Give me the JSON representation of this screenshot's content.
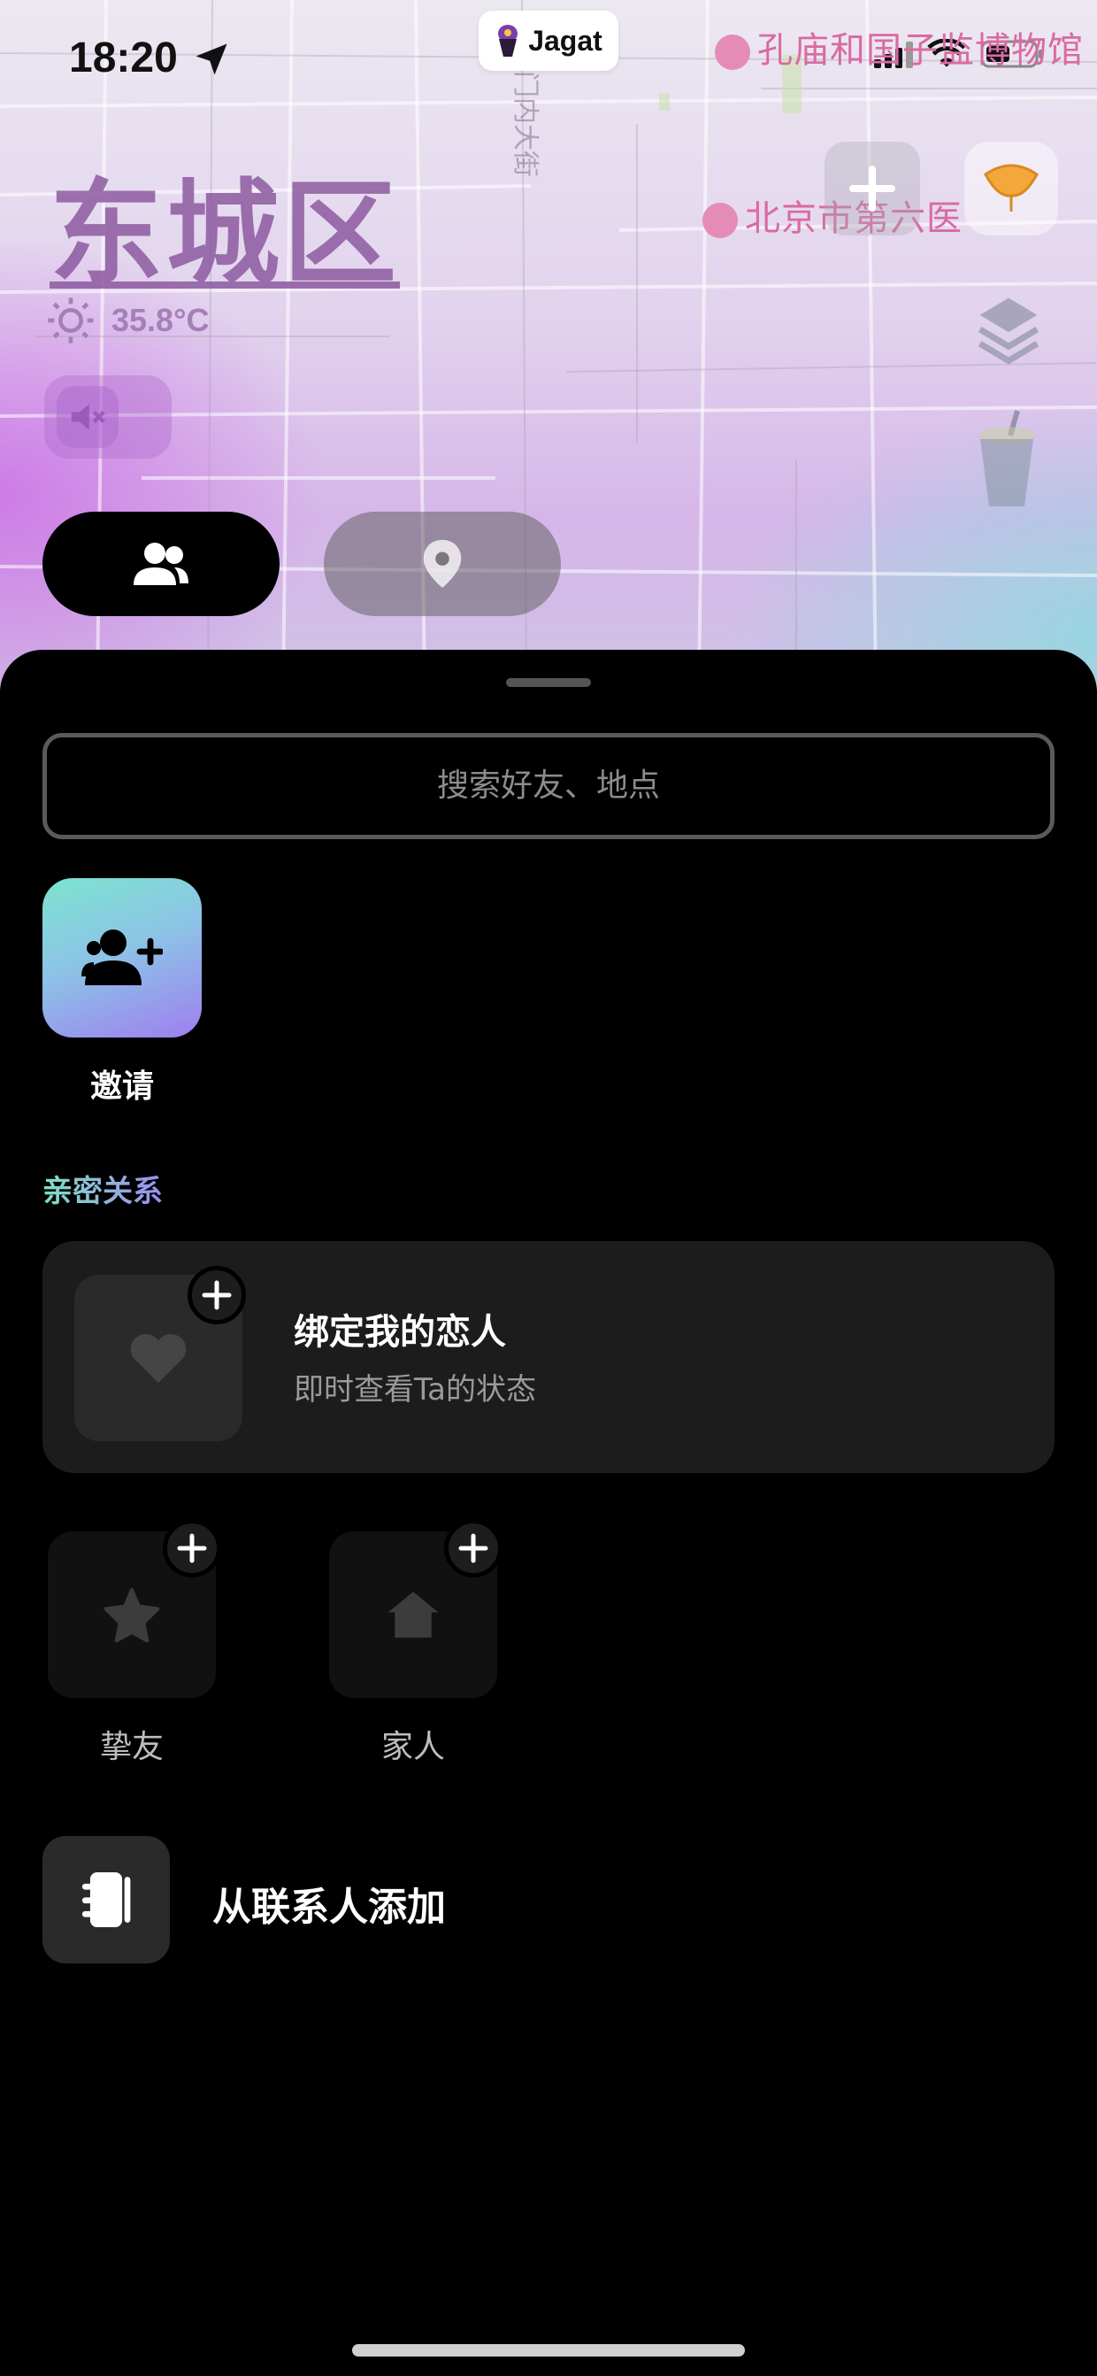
{
  "status_bar": {
    "time": "18:20",
    "app_badge": "Jagat"
  },
  "map": {
    "district": "东城区",
    "temperature": "35.8°C",
    "poi_labels": [
      "孔庙和国子监博物馆",
      "北京市第六医"
    ],
    "street_label": "门内大街",
    "mute_state": "muted"
  },
  "mode_toggle": {
    "selected": "friends",
    "options": [
      "friends-icon",
      "location-pin-icon"
    ]
  },
  "sheet": {
    "search_placeholder": "搜索好友、地点",
    "invite_label": "邀请",
    "section_title": "亲密关系",
    "lover_card": {
      "title": "绑定我的恋人",
      "subtitle": "即时查看Ta的状态"
    },
    "groups": [
      {
        "label": "挚友",
        "icon": "star-icon"
      },
      {
        "label": "家人",
        "icon": "house-icon"
      }
    ],
    "contacts_label": "从联系人添加"
  },
  "colors": {
    "accent_gradient_start": "#7ce4cf",
    "accent_gradient_end": "#9e7ff0",
    "sheet_bg": "#000000",
    "card_bg": "#1c1c1c"
  }
}
